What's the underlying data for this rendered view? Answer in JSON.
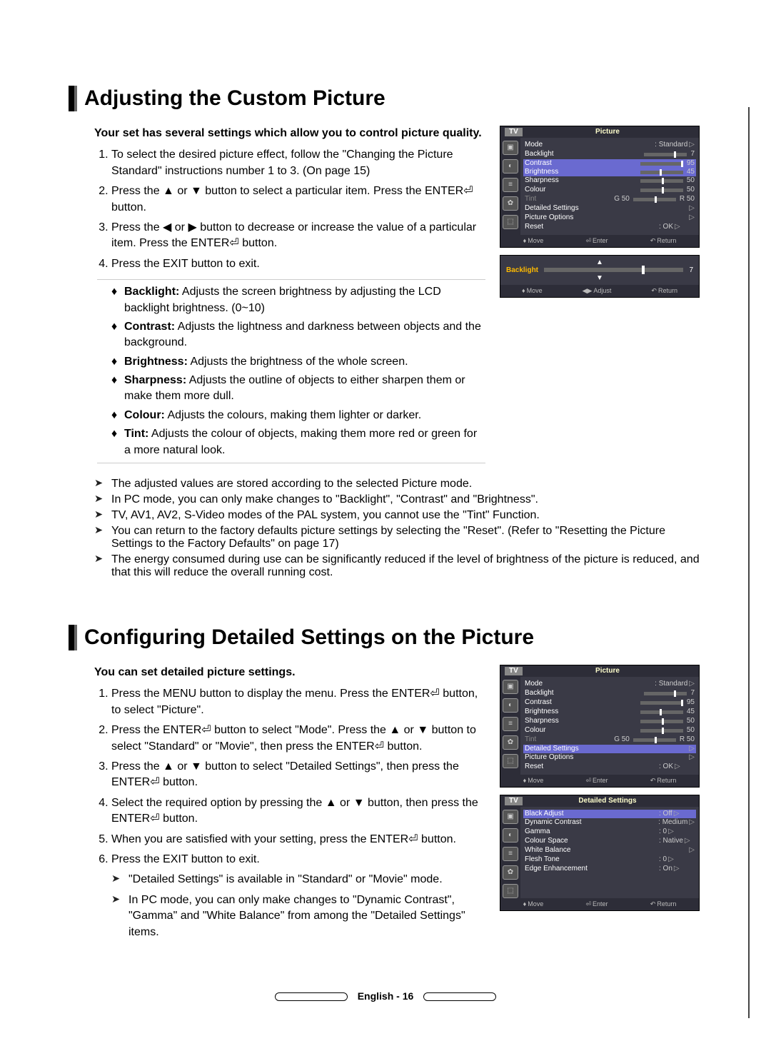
{
  "section1": {
    "title": "Adjusting the Custom Picture",
    "intro": "Your set has several settings which allow you to control picture quality.",
    "steps": [
      "To select the desired picture effect, follow the \"Changing the Picture Standard\" instructions number 1 to 3. (On page 15)",
      "Press the ▲ or ▼ button to select a particular item. Press the ENTER⏎ button.",
      "Press the ◀ or ▶ button to decrease or increase the value of a particular item. Press the ENTER⏎ button.",
      "Press the EXIT button to exit."
    ],
    "definitions": [
      {
        "term": "Backlight:",
        "desc": "Adjusts the screen brightness by adjusting the LCD backlight brightness. (0~10)"
      },
      {
        "term": "Contrast:",
        "desc": "Adjusts the lightness and darkness between objects and the background."
      },
      {
        "term": "Brightness:",
        "desc": "Adjusts the brightness of the whole screen."
      },
      {
        "term": "Sharpness:",
        "desc": "Adjusts the outline of objects to either sharpen them or make them more dull."
      },
      {
        "term": "Colour:",
        "desc": "Adjusts the colours, making them lighter or darker."
      },
      {
        "term": "Tint:",
        "desc": "Adjusts the colour of objects, making them more red or green for a more natural look."
      }
    ],
    "notes": [
      "The adjusted values are stored according to the selected Picture mode.",
      "In PC mode, you can only make changes to \"Backlight\", \"Contrast\" and \"Brightness\".",
      "TV, AV1, AV2, S-Video modes of the PAL system, you cannot use the \"Tint\" Function.",
      "You can return to the factory defaults picture settings by selecting the \"Reset\". (Refer to \"Resetting the Picture Settings to the Factory Defaults\" on page 17)",
      "The energy consumed during use can be significantly reduced if the level of brightness of the picture is reduced, and that this will reduce the overall running cost."
    ]
  },
  "section2": {
    "title": "Configuring Detailed Settings on the Picture",
    "intro": "You can set detailed picture settings.",
    "steps": [
      "Press the MENU button to display the menu. Press the ENTER⏎ button, to select \"Picture\".",
      "Press the ENTER⏎ button to select \"Mode\". Press the ▲ or ▼ button to select \"Standard\" or \"Movie\", then press the ENTER⏎ button.",
      "Press the ▲ or ▼ button to select \"Detailed Settings\", then press the ENTER⏎ button.",
      "Select the required option by pressing the ▲ or ▼ button, then press the ENTER⏎ button.",
      "When you are satisfied with your setting, press the ENTER⏎ button.",
      "Press the EXIT button to exit."
    ],
    "subnotes": [
      "\"Detailed Settings\" is available in \"Standard\" or \"Movie\" mode.",
      "In PC mode, you can only make changes to \"Dynamic Contrast\", \"Gamma\" and \"White Balance\" from among the \"Detailed Settings\" items."
    ]
  },
  "osd": {
    "tv": "TV",
    "picture_title": "Picture",
    "detailed_title": "Detailed Settings",
    "picture_menu": {
      "mode": {
        "label": "Mode",
        "value": ": Standard"
      },
      "backlight": {
        "label": "Backlight",
        "value": "7"
      },
      "contrast": {
        "label": "Contrast",
        "value": "95"
      },
      "brightness": {
        "label": "Brightness",
        "value": "45"
      },
      "sharpness": {
        "label": "Sharpness",
        "value": "50"
      },
      "colour": {
        "label": "Colour",
        "value": "50"
      },
      "tint": {
        "label": "Tint",
        "value_left": "G 50",
        "value_right": "R 50"
      },
      "detailed": {
        "label": "Detailed Settings"
      },
      "options": {
        "label": "Picture Options"
      },
      "reset": {
        "label": "Reset",
        "value": ": OK"
      }
    },
    "detailed_menu": {
      "black": {
        "label": "Black Adjust",
        "value": ": Off"
      },
      "dyn": {
        "label": "Dynamic Contrast",
        "value": ": Medium"
      },
      "gamma": {
        "label": "Gamma",
        "value": ": 0"
      },
      "cspace": {
        "label": "Colour Space",
        "value": ": Native"
      },
      "wb": {
        "label": "White Balance"
      },
      "flesh": {
        "label": "Flesh Tone",
        "value": ": 0"
      },
      "edge": {
        "label": "Edge Enhancement",
        "value": ": On"
      }
    },
    "slider_popup": {
      "up": "▲",
      "down": "▼",
      "label": "Backlight",
      "value": "7"
    },
    "footer": {
      "move": "Move",
      "enter": "Enter",
      "return": "Return",
      "adjust": "Adjust"
    }
  },
  "page_footer": "English - 16"
}
